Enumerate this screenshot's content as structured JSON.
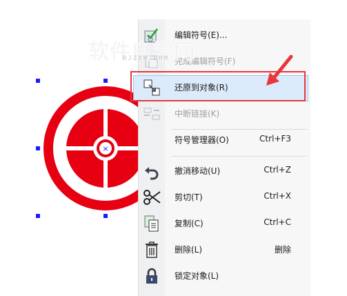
{
  "watermark": {
    "main": "软件自学网",
    "sub": "RJZXW.COM"
  },
  "context_menu": {
    "items": [
      {
        "label": "编辑符号(E)...",
        "shortcut": "",
        "icon": "edit-symbol-icon",
        "enabled": true
      },
      {
        "label": "完成编辑符号(F)",
        "shortcut": "",
        "icon": "finish-edit-symbol-icon",
        "enabled": false
      },
      {
        "label": "还原到对象(R)",
        "shortcut": "",
        "icon": "revert-to-object-icon",
        "enabled": true,
        "highlighted": true
      },
      {
        "label": "中断链接(K)",
        "shortcut": "",
        "icon": "break-link-icon",
        "enabled": false
      },
      {
        "label": "符号管理器(O)",
        "shortcut": "Ctrl+F3",
        "icon": "",
        "enabled": true
      },
      {
        "label": "撤消移动(U)",
        "shortcut": "Ctrl+Z",
        "icon": "undo-icon",
        "enabled": true
      },
      {
        "label": "剪切(T)",
        "shortcut": "Ctrl+X",
        "icon": "scissors-icon",
        "enabled": true
      },
      {
        "label": "复制(C)",
        "shortcut": "Ctrl+C",
        "icon": "copy-icon",
        "enabled": true
      },
      {
        "label": "删除(L)",
        "shortcut": "删除",
        "icon": "trash-icon",
        "enabled": true
      },
      {
        "label": "锁定对象(L)",
        "shortcut": "",
        "icon": "lock-icon",
        "enabled": true
      }
    ]
  },
  "colors": {
    "symbol_red": "#e60012",
    "selection_handle": "#1a1aff",
    "highlight_bg": "#dcebfb",
    "annotation_red": "#e8363a"
  }
}
